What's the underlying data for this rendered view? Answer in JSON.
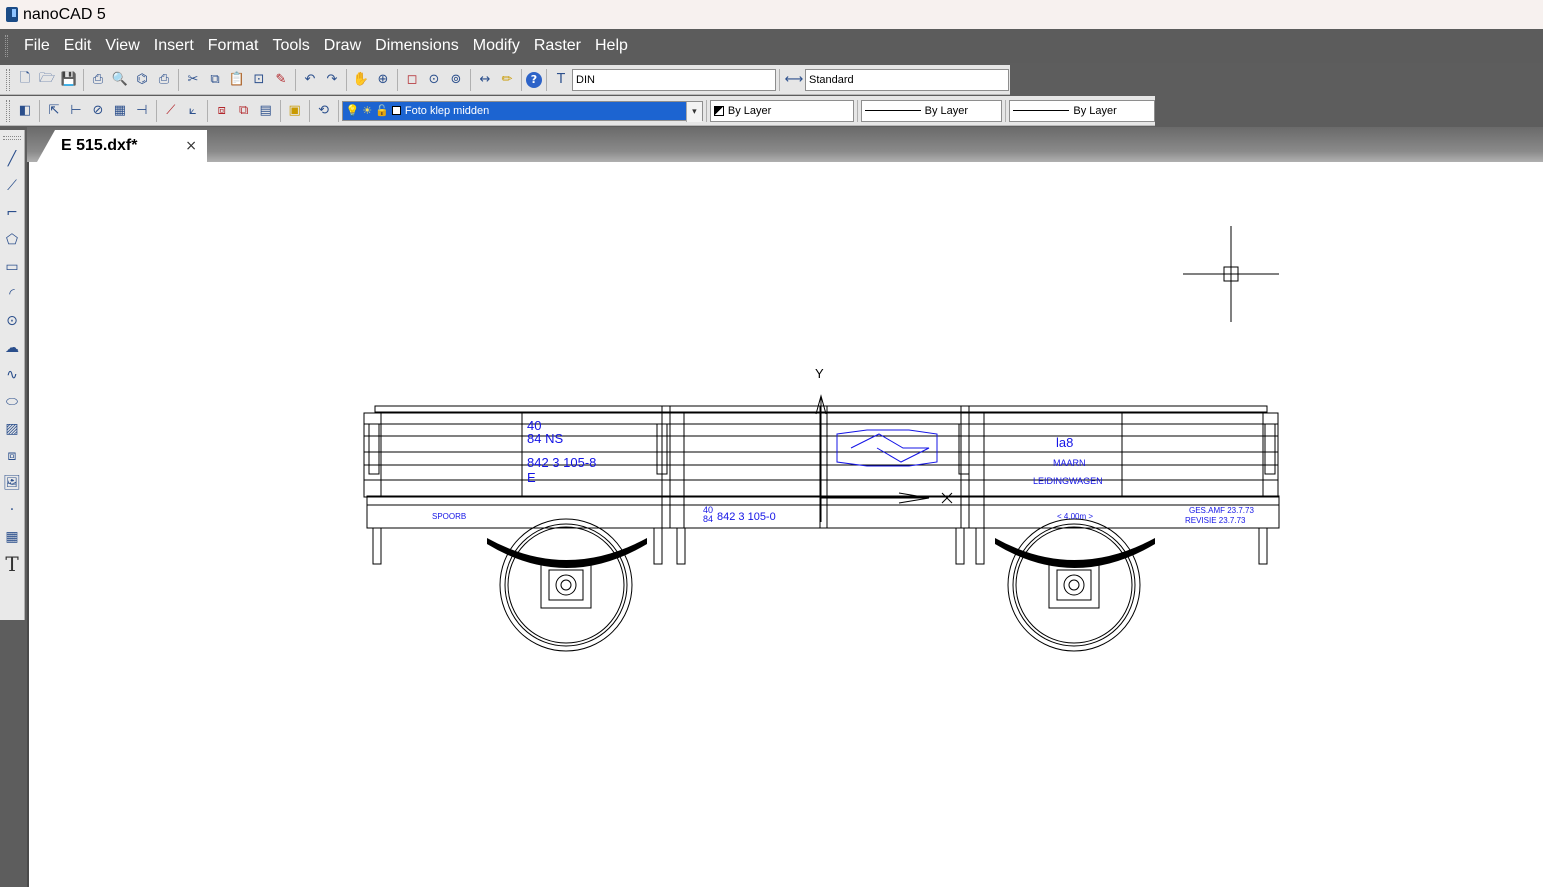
{
  "window": {
    "title": "nanoCAD 5"
  },
  "menu": [
    "File",
    "Edit",
    "View",
    "Insert",
    "Format",
    "Tools",
    "Draw",
    "Dimensions",
    "Modify",
    "Raster",
    "Help"
  ],
  "toolbar1": {
    "text_style_value": "DIN",
    "dim_style_value": "Standard"
  },
  "toolbar2": {
    "layer_value": "Foto klep midden",
    "color_value": "By Layer",
    "linetype_value": "By Layer",
    "lineweight_value": "By Layer"
  },
  "document_tab": {
    "label": "E 515.dxf*",
    "close": "×"
  },
  "drawing": {
    "ucs_axis_label": "Y",
    "texts": {
      "t40": "40",
      "t84ns": "84 NS",
      "tnum": "842 3 105-8",
      "tE": "E",
      "tla8": "la8",
      "tmaarn": "MAARN",
      "tleiding": "LEIDINGWAGEN",
      "tbottom": "842 3 105-0",
      "tbot40": "40",
      "tbot84": "84",
      "tlen": "< 4.00m >",
      "tges": "GES.AMF 23.7.73",
      "trev": "REVISIE 23.7.73",
      "tleft": "SPOORB"
    }
  },
  "colors": {
    "menubar_bg": "#5c5c5c",
    "toolbar_bg": "#e6e6e6",
    "layer_highlight": "#1c64d1",
    "drawing_line": "#000000",
    "drawing_text": "#1414e6"
  }
}
